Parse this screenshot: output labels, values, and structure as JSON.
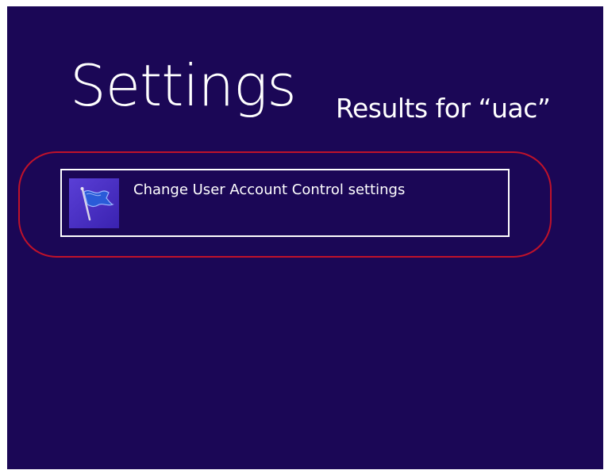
{
  "header": {
    "title": "Settings",
    "results_label": "Results for “uac”"
  },
  "results": [
    {
      "label": "Change User Account Control settings",
      "icon": "uac-flag-icon"
    }
  ],
  "colors": {
    "background": "#1b0756",
    "text": "#ffffff",
    "highlight": "#c0122a",
    "icon_tile": "#4a30c8"
  }
}
